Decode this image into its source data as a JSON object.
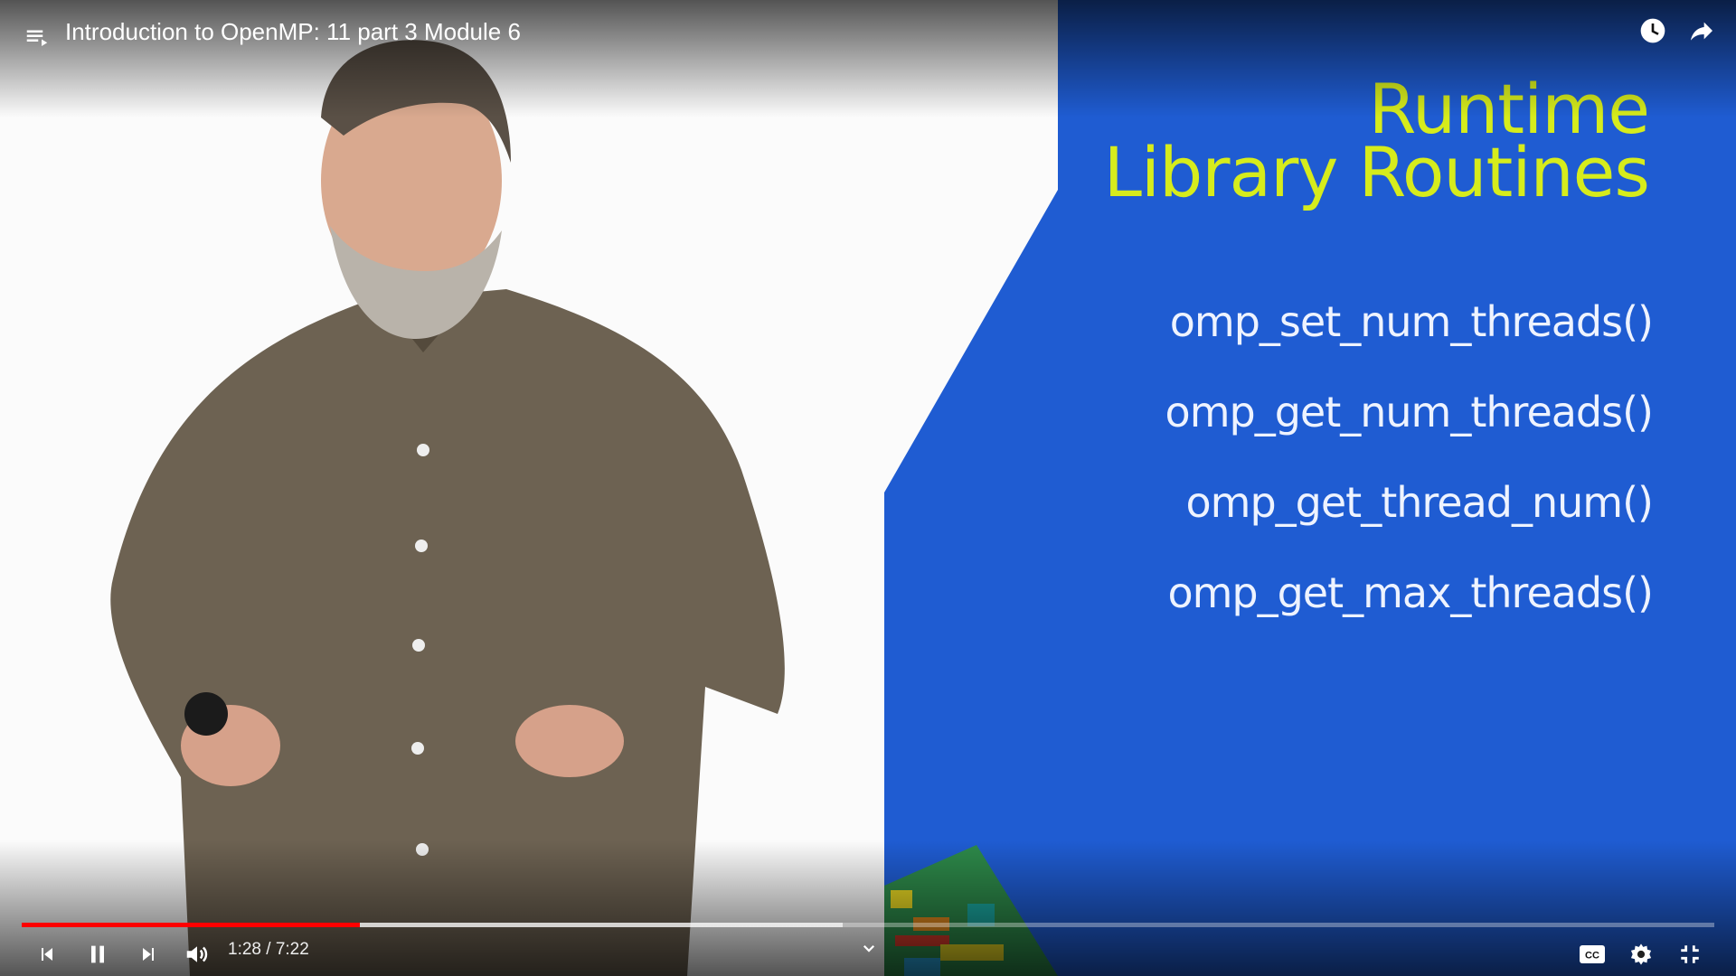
{
  "player": {
    "title": "Introduction to OpenMP: 11 part 3 Module 6",
    "time_display": "1:28 / 7:22",
    "progress_played": 0.2,
    "progress_buffered": 0.485
  },
  "slide": {
    "title_line1": "Runtime",
    "title_line2": "Library Routines",
    "items": [
      "omp_set_num_threads()",
      "omp_get_num_threads()",
      "omp_get_thread_num()",
      "omp_get_max_threads()"
    ]
  },
  "colors": {
    "slide_blue": "#1f5cd2",
    "slide_title": "#d6ec1c",
    "progress_red": "#ff0000"
  },
  "icons": [
    "playlist-icon",
    "watch-later-icon",
    "share-icon",
    "previous-icon",
    "pause-icon",
    "next-icon",
    "volume-icon",
    "chevron-down-icon",
    "captions-icon",
    "settings-icon",
    "exit-fullscreen-icon"
  ]
}
